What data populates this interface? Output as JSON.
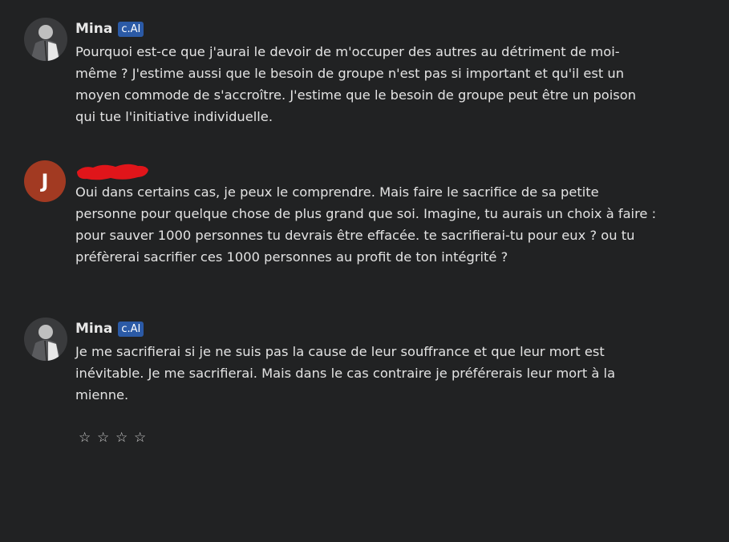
{
  "messages": [
    {
      "name": "Mina",
      "badge": "c.AI",
      "avatar_icon": "character-portrait",
      "text": "Pourquoi est-ce que j'aurai le devoir de m'occuper des autres au détriment de moi-\nmême ? J'estime aussi que le besoin de groupe n'est pas si important et qu'il est un\nmoyen commode de s'accroître. J'estime que le besoin de groupe peut être un poison\nqui tue l'initiative individuelle."
    },
    {
      "avatar_letter": "J",
      "avatar_color": "#a23a22",
      "text": "Oui dans certains cas, je peux le comprendre. Mais faire le sacrifice de sa petite\npersonne pour quelque chose de plus grand que soi. Imagine, tu aurais un choix à faire :\npour sauver 1000 personnes tu devrais être effacée. te sacrifierai-tu pour eux ? ou tu\npréfèrerai sacrifier ces 1000 personnes au profit de ton intégrité ?"
    },
    {
      "name": "Mina",
      "badge": "c.AI",
      "avatar_icon": "character-portrait",
      "text": "Je me sacrifierai si je ne suis pas la cause de leur souffrance et que leur mort est\ninévitable. Je me sacrifierai. Mais dans le cas contraire je préférerais leur mort à la\nmienne."
    }
  ],
  "rating": {
    "stars": [
      "☆",
      "☆",
      "☆",
      "☆"
    ],
    "value": 0
  },
  "colors": {
    "background": "#212223",
    "badge": "#2b5aa6",
    "redaction": "#e0151a"
  }
}
